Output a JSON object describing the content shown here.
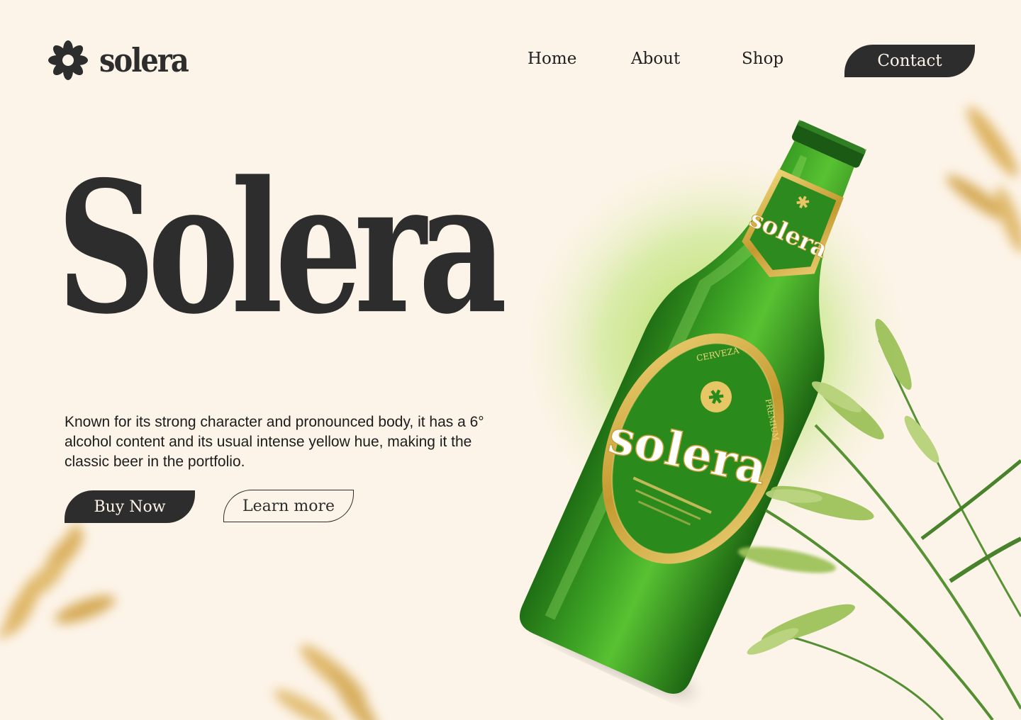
{
  "brand": {
    "name": "solera"
  },
  "nav": {
    "items": [
      {
        "label": "Home"
      },
      {
        "label": "About"
      },
      {
        "label": "Shop"
      }
    ],
    "contact_label": "Contact"
  },
  "hero": {
    "title": "Solera",
    "description": "Known for its strong character and pronounced body, it has a 6° alcohol content and its usual intense yellow hue, making it the classic beer in the portfolio.",
    "buy_label": "Buy Now",
    "learn_label": "Learn more"
  },
  "bottle": {
    "brand": "solera",
    "label_top": "CERVEZA",
    "label_side": "PREMIUM"
  },
  "colors": {
    "background": "#fdf4e9",
    "dark": "#2d2d2d",
    "bottle_green": "#2f8a1e",
    "gold": "#c9a13a",
    "wheat": "#d8b25a"
  }
}
